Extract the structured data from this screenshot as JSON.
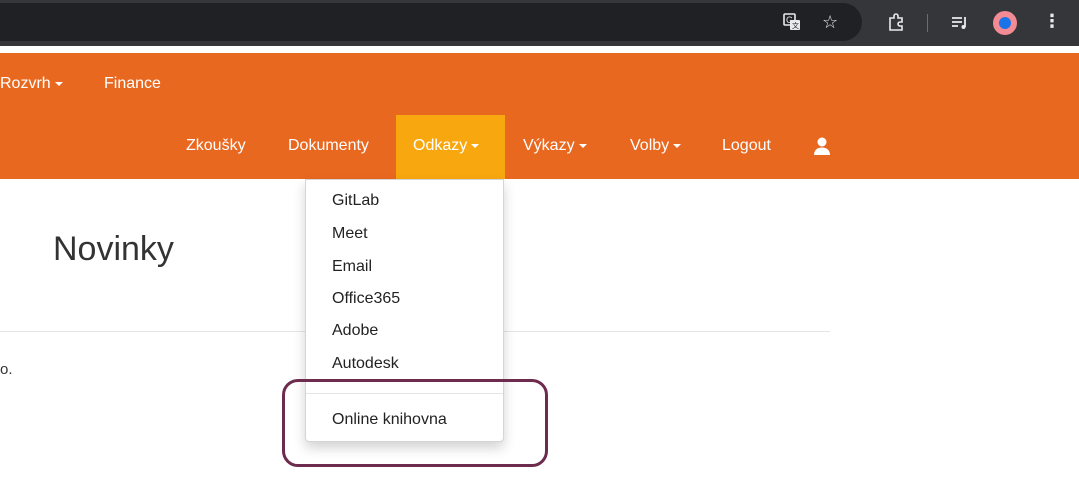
{
  "browser": {
    "icons": [
      "translate-icon",
      "star-icon",
      "extensions-icon",
      "reading-list-icon",
      "profile-avatar",
      "menu-dots-icon"
    ]
  },
  "navbar": {
    "row1": [
      {
        "label": "Rozvrh",
        "dropdown": true
      },
      {
        "label": "Finance",
        "dropdown": false
      }
    ],
    "row2": [
      {
        "label": "Zkoušky",
        "dropdown": false
      },
      {
        "label": "Dokumenty",
        "dropdown": false
      },
      {
        "label": "Odkazy",
        "dropdown": true,
        "active": true
      },
      {
        "label": "Výkazy",
        "dropdown": true
      },
      {
        "label": "Volby",
        "dropdown": true
      },
      {
        "label": "Logout",
        "dropdown": false
      }
    ],
    "user_icon": "user-icon",
    "colors": {
      "bar": "#e96820",
      "active": "#f8a70f"
    }
  },
  "page": {
    "title": "Novinky",
    "truncated_text": "o."
  },
  "dropdown": {
    "items": [
      "GitLab",
      "Meet",
      "Email",
      "Office365",
      "Adobe",
      "Autodesk"
    ],
    "after_divider": [
      "Online knihovna"
    ]
  },
  "annotation": {
    "color": "#6d2b4d",
    "highlights": "Online knihovna"
  }
}
